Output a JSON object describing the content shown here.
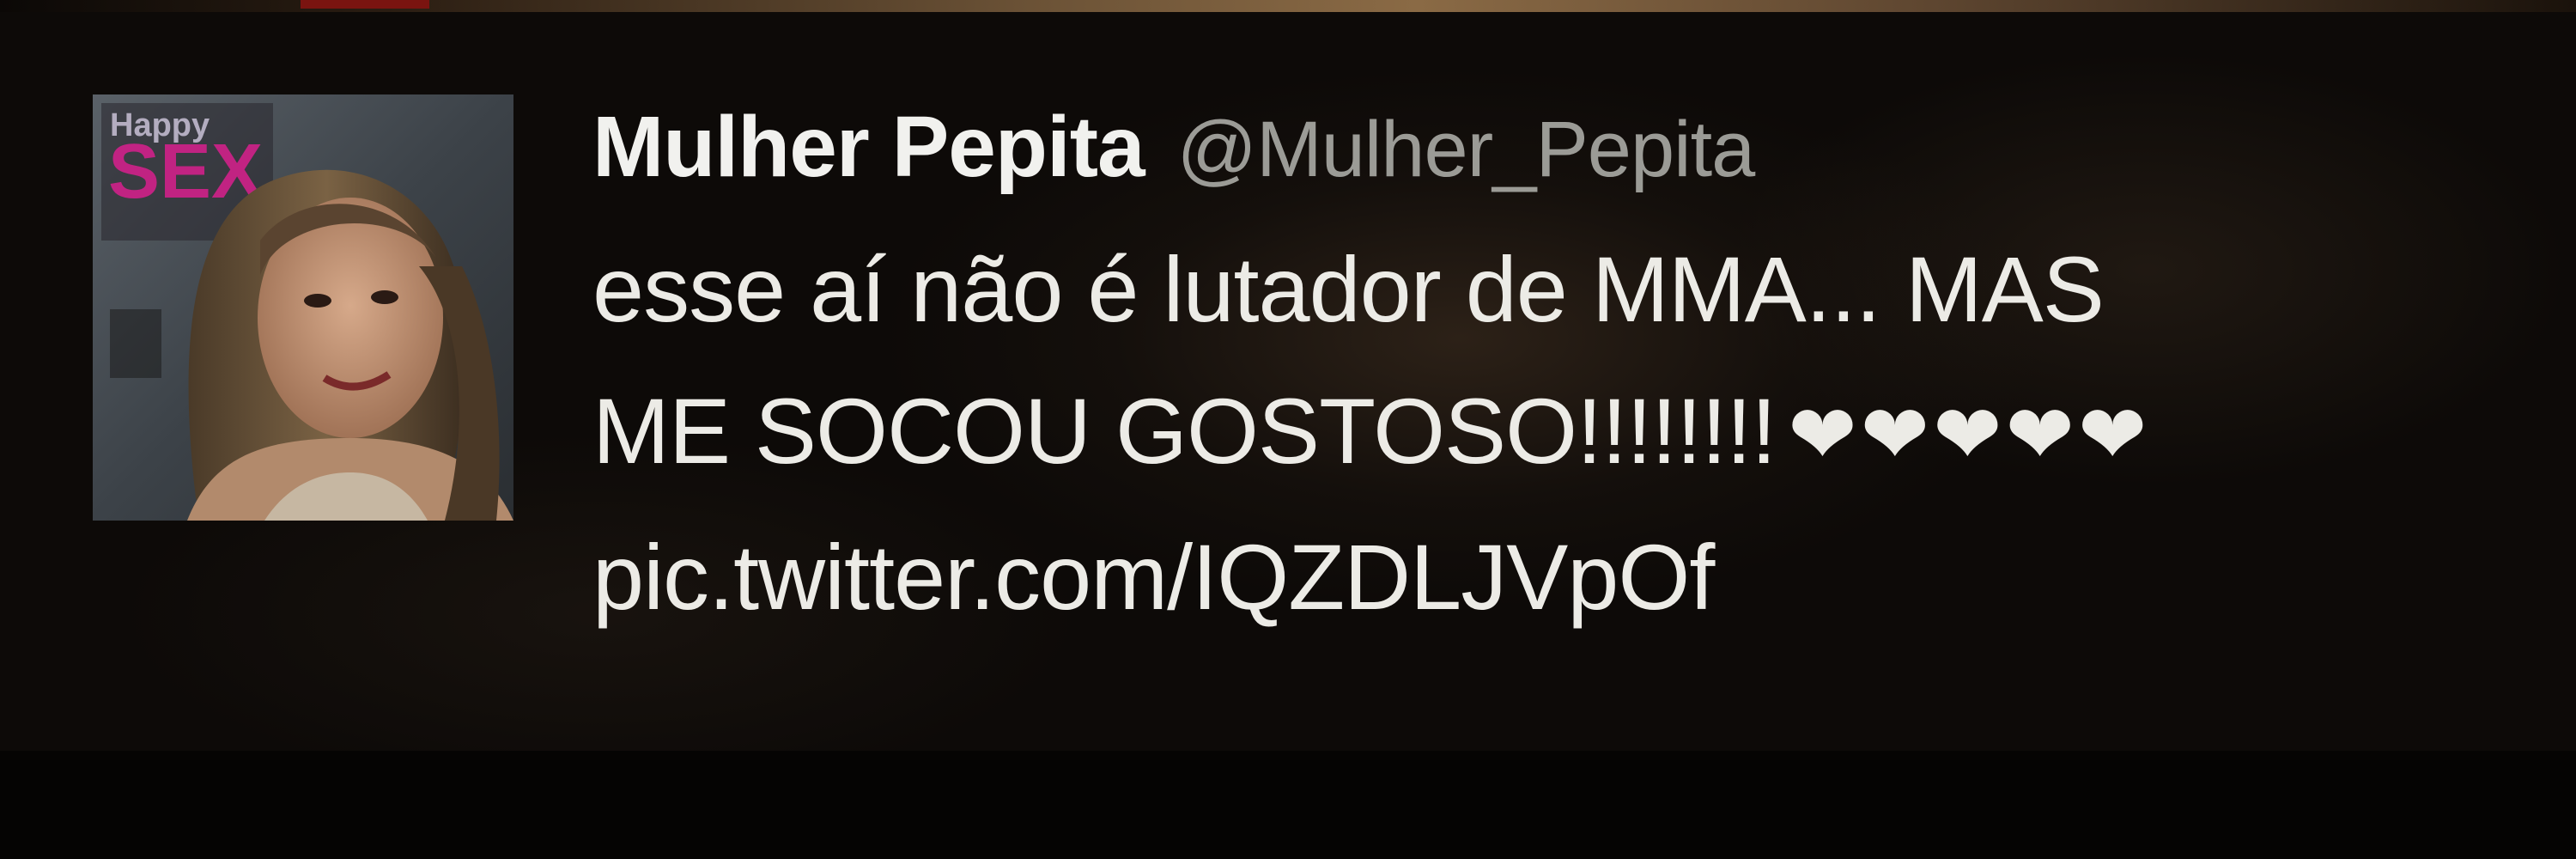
{
  "tweet": {
    "display_name": "Mulher Pepita",
    "handle": "@Mulher_Pepita",
    "text_line_1": "esse aí não é lutador de MMA... MAS",
    "text_line_2": "ME SOCOU GOSTOSO!!!!!!!!",
    "hearts": "❤❤❤❤❤",
    "link": "pic.twitter.com/IQZDLJVpOf",
    "avatar_overlay_text": "Happy SEX"
  },
  "colors": {
    "background": "#050403",
    "name": "#f1f1ee",
    "handle": "#9b9b96",
    "text": "#ecebe6"
  }
}
